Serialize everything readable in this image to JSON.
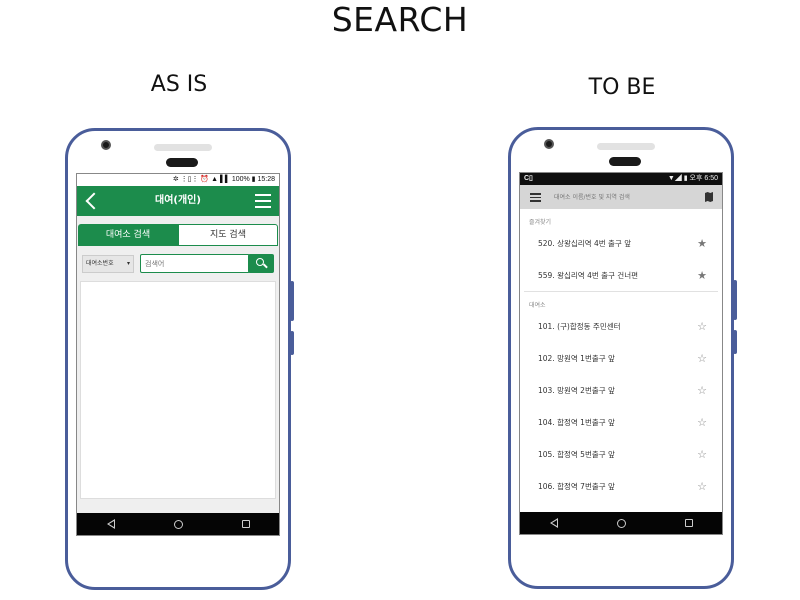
{
  "page": {
    "title": "SEARCH",
    "as_is_label": "AS IS",
    "to_be_label": "TO BE"
  },
  "as_is": {
    "status": {
      "right": "✲ ⋮▯⋮ ⏰ ▲ ▌▌ 100% ▮ 15:28"
    },
    "appbar": {
      "title": "대여(개인)",
      "back_icon": "back-chevron-icon",
      "menu_icon": "hamburger-icon"
    },
    "tabs": [
      {
        "label": "대여소 검색",
        "active": true
      },
      {
        "label": "지도 검색",
        "active": false
      }
    ],
    "search": {
      "type_select": "대여소번호",
      "type_caret": "▾",
      "placeholder": "검색어",
      "button_icon": "search-icon"
    },
    "colors": {
      "accent": "#1c8c4c"
    }
  },
  "to_be": {
    "status": {
      "left": "C▯",
      "right": "▼◢ ▮ 오후 6:50"
    },
    "search": {
      "placeholder": "대여소 이름/번호 및 지역 검색",
      "menu_icon": "hamburger-icon",
      "map_icon": "map-icon"
    },
    "favorites": {
      "label": "즐겨찾기",
      "items": [
        {
          "label": "520. 상왕십리역 4번 출구 앞",
          "star": "★"
        },
        {
          "label": "559. 왕십리역 4번 출구 건너편",
          "star": "★"
        }
      ]
    },
    "stations": {
      "label": "대여소",
      "items": [
        {
          "label": "101. (구)합정동 주민센터",
          "star": "☆"
        },
        {
          "label": "102. 망원역 1번출구 앞",
          "star": "☆"
        },
        {
          "label": "103. 망원역 2번출구 앞",
          "star": "☆"
        },
        {
          "label": "104. 합정역 1번출구 앞",
          "star": "☆"
        },
        {
          "label": "105. 합정역 5번출구 앞",
          "star": "☆"
        },
        {
          "label": "106. 합정역 7번출구 앞",
          "star": "☆"
        }
      ]
    }
  },
  "nav": {
    "back_icon": "nav-back-icon",
    "home_icon": "nav-home-icon",
    "recent_icon": "nav-recent-icon"
  }
}
